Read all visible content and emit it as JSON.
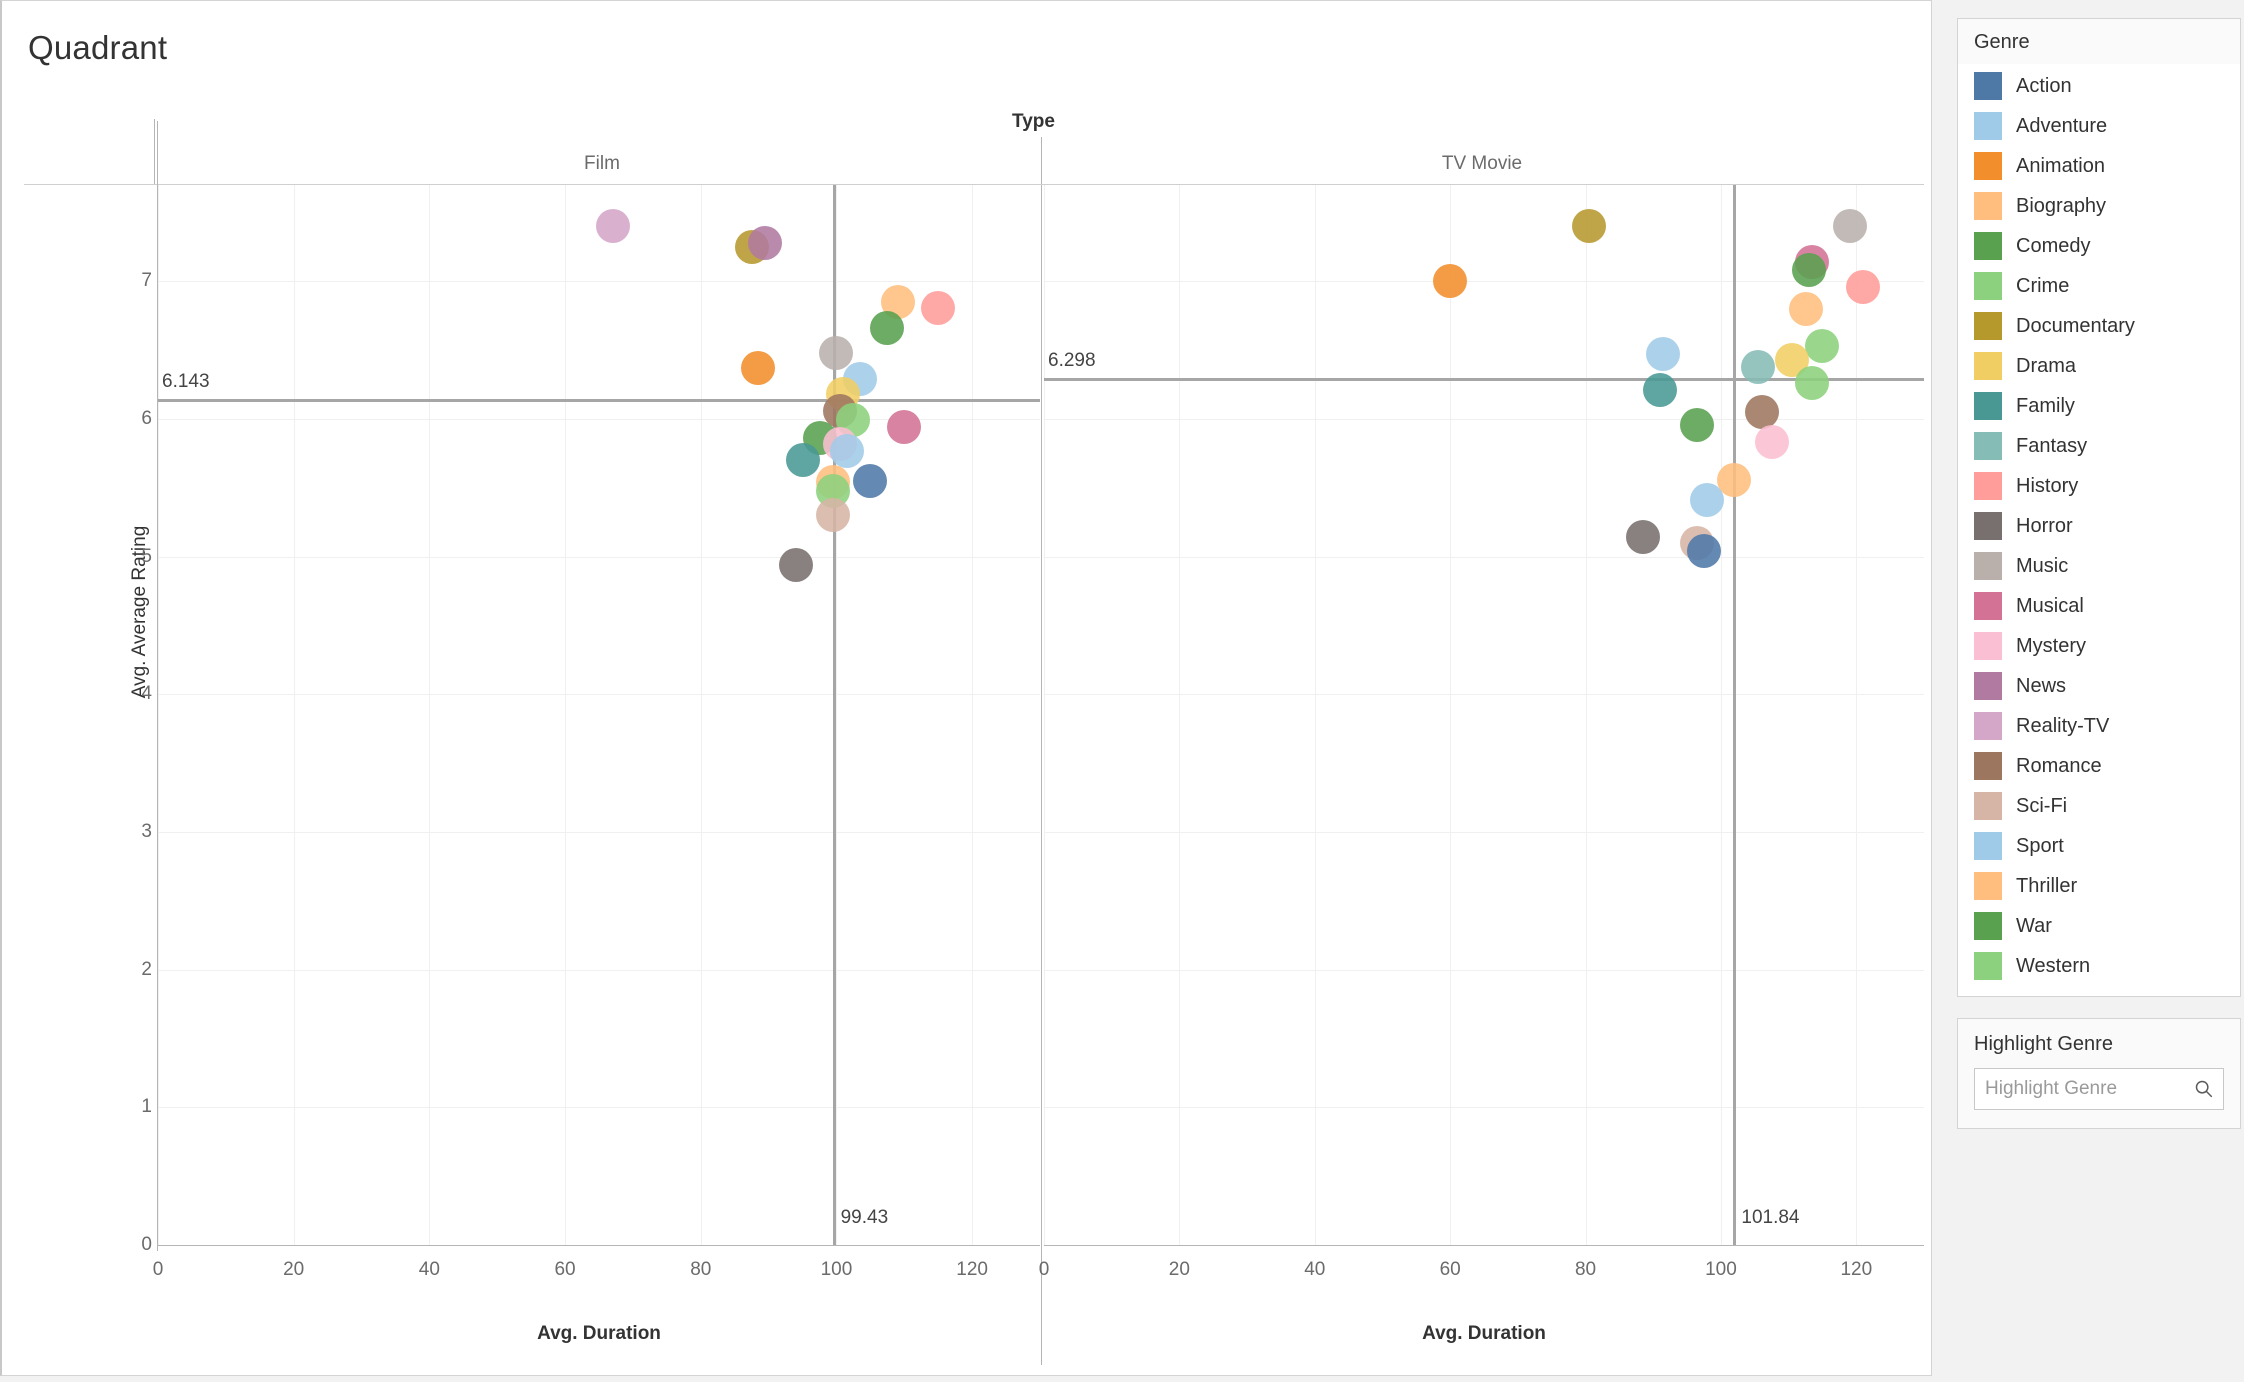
{
  "title": "Quadrant",
  "column_header": {
    "field": "Type",
    "panes": [
      "Film",
      "TV Movie"
    ]
  },
  "axes": {
    "y_title": "Avg. Average Rating",
    "x_title": "Avg. Duration",
    "y_ticks": [
      "0",
      "1",
      "2",
      "3",
      "4",
      "5",
      "6",
      "7"
    ],
    "x_ticks": [
      "0",
      "20",
      "40",
      "60",
      "80",
      "100",
      "120"
    ]
  },
  "reference_lines": {
    "film_avg_rating": "6.143",
    "film_avg_duration": "99.43",
    "tv_avg_rating": "6.298",
    "tv_avg_duration": "101.84"
  },
  "legend": {
    "title": "Genre",
    "items": [
      {
        "label": "Action",
        "color": "#4e79a7"
      },
      {
        "label": "Adventure",
        "color": "#a0cbe8"
      },
      {
        "label": "Animation",
        "color": "#f28e2b"
      },
      {
        "label": "Biography",
        "color": "#ffbe7d"
      },
      {
        "label": "Comedy",
        "color": "#59a14f"
      },
      {
        "label": "Crime",
        "color": "#8cd17d"
      },
      {
        "label": "Documentary",
        "color": "#b6992d"
      },
      {
        "label": "Drama",
        "color": "#f1ce63"
      },
      {
        "label": "Family",
        "color": "#499894"
      },
      {
        "label": "Fantasy",
        "color": "#86bcb6"
      },
      {
        "label": "History",
        "color": "#ff9d9a"
      },
      {
        "label": "Horror",
        "color": "#77706e"
      },
      {
        "label": "Music",
        "color": "#b9b0ac"
      },
      {
        "label": "Musical",
        "color": "#d37295"
      },
      {
        "label": "Mystery",
        "color": "#fabfd2"
      },
      {
        "label": "News",
        "color": "#b07aa1"
      },
      {
        "label": "Reality-TV",
        "color": "#d4a6c8"
      },
      {
        "label": "Romance",
        "color": "#9d7660"
      },
      {
        "label": "Sci-Fi",
        "color": "#d7b5a6"
      },
      {
        "label": "Sport",
        "color": "#a0cbe8"
      },
      {
        "label": "Thriller",
        "color": "#ffbe7d"
      },
      {
        "label": "War",
        "color": "#59a14f"
      },
      {
        "label": "Western",
        "color": "#8cd17d"
      }
    ]
  },
  "highlight": {
    "title": "Highlight Genre",
    "placeholder": "Highlight Genre",
    "value": "",
    "icon": "search-icon"
  },
  "chart_data": {
    "type": "scatter",
    "title": "Quadrant",
    "xlabel": "Avg. Duration",
    "ylabel": "Avg. Average Rating",
    "xlim": [
      0,
      130
    ],
    "ylim": [
      0,
      7.7
    ],
    "grid": true,
    "legend_position": "right",
    "facet_field": "Type",
    "panels": [
      {
        "name": "Film",
        "ref_x": 99.43,
        "ref_y": 6.143,
        "points": [
          {
            "genre": "Reality-TV",
            "x": 67.0,
            "y": 7.4,
            "color": "#d4a6c8"
          },
          {
            "genre": "Documentary",
            "x": 87.5,
            "y": 7.25,
            "color": "#b6992d"
          },
          {
            "genre": "News",
            "x": 89.5,
            "y": 7.28,
            "color": "#b07aa1"
          },
          {
            "genre": "Biography",
            "x": 109.0,
            "y": 6.85,
            "color": "#ffbe7d"
          },
          {
            "genre": "History",
            "x": 115.0,
            "y": 6.81,
            "color": "#ff9d9a"
          },
          {
            "genre": "War",
            "x": 107.5,
            "y": 6.66,
            "color": "#59a14f"
          },
          {
            "genre": "Music",
            "x": 100.0,
            "y": 6.48,
            "color": "#b9b0ac"
          },
          {
            "genre": "Animation",
            "x": 88.5,
            "y": 6.37,
            "color": "#f28e2b"
          },
          {
            "genre": "Adventure",
            "x": 103.5,
            "y": 6.29,
            "color": "#a0cbe8"
          },
          {
            "genre": "Drama",
            "x": 101.0,
            "y": 6.18,
            "color": "#f1ce63"
          },
          {
            "genre": "Romance",
            "x": 100.5,
            "y": 6.06,
            "color": "#9d7660"
          },
          {
            "genre": "Crime",
            "x": 102.5,
            "y": 5.99,
            "color": "#8cd17d"
          },
          {
            "genre": "Musical",
            "x": 110.0,
            "y": 5.94,
            "color": "#d37295"
          },
          {
            "genre": "Comedy",
            "x": 97.5,
            "y": 5.86,
            "color": "#59a14f"
          },
          {
            "genre": "Mystery",
            "x": 100.5,
            "y": 5.82,
            "color": "#fabfd2"
          },
          {
            "genre": "Sport",
            "x": 101.5,
            "y": 5.77,
            "color": "#a0cbe8"
          },
          {
            "genre": "Family",
            "x": 95.0,
            "y": 5.7,
            "color": "#499894"
          },
          {
            "genre": "Action",
            "x": 105.0,
            "y": 5.55,
            "color": "#4e79a7"
          },
          {
            "genre": "Thriller",
            "x": 99.5,
            "y": 5.54,
            "color": "#ffbe7d"
          },
          {
            "genre": "Western",
            "x": 99.5,
            "y": 5.48,
            "color": "#8cd17d"
          },
          {
            "genre": "Sci-Fi",
            "x": 99.5,
            "y": 5.3,
            "color": "#d7b5a6"
          },
          {
            "genre": "Horror",
            "x": 94.0,
            "y": 4.94,
            "color": "#77706e"
          }
        ]
      },
      {
        "name": "TV Movie",
        "ref_x": 101.84,
        "ref_y": 6.298,
        "points": [
          {
            "genre": "Music",
            "x": 119.0,
            "y": 7.4,
            "color": "#b9b0ac"
          },
          {
            "genre": "Documentary",
            "x": 80.5,
            "y": 7.4,
            "color": "#b6992d"
          },
          {
            "genre": "Musical",
            "x": 113.5,
            "y": 7.14,
            "color": "#d37295"
          },
          {
            "genre": "War",
            "x": 113.0,
            "y": 7.08,
            "color": "#59a14f"
          },
          {
            "genre": "Animation",
            "x": 60.0,
            "y": 7.0,
            "color": "#f28e2b"
          },
          {
            "genre": "History",
            "x": 121.0,
            "y": 6.96,
            "color": "#ff9d9a"
          },
          {
            "genre": "Biography",
            "x": 112.5,
            "y": 6.8,
            "color": "#ffbe7d"
          },
          {
            "genre": "Crime",
            "x": 115.0,
            "y": 6.53,
            "color": "#8cd17d"
          },
          {
            "genre": "Adventure",
            "x": 91.5,
            "y": 6.47,
            "color": "#a0cbe8"
          },
          {
            "genre": "Drama",
            "x": 110.5,
            "y": 6.43,
            "color": "#f1ce63"
          },
          {
            "genre": "Fantasy",
            "x": 105.5,
            "y": 6.38,
            "color": "#86bcb6"
          },
          {
            "genre": "Western",
            "x": 113.5,
            "y": 6.26,
            "color": "#8cd17d"
          },
          {
            "genre": "Family",
            "x": 91.0,
            "y": 6.21,
            "color": "#499894"
          },
          {
            "genre": "Romance",
            "x": 106.0,
            "y": 6.05,
            "color": "#9d7660"
          },
          {
            "genre": "Comedy",
            "x": 96.5,
            "y": 5.96,
            "color": "#59a14f"
          },
          {
            "genre": "Mystery",
            "x": 107.5,
            "y": 5.83,
            "color": "#fabfd2"
          },
          {
            "genre": "Thriller",
            "x": 102.0,
            "y": 5.56,
            "color": "#ffbe7d"
          },
          {
            "genre": "Sport",
            "x": 98.0,
            "y": 5.41,
            "color": "#a0cbe8"
          },
          {
            "genre": "Horror",
            "x": 88.5,
            "y": 5.14,
            "color": "#77706e"
          },
          {
            "genre": "Sci-Fi",
            "x": 96.5,
            "y": 5.1,
            "color": "#d7b5a6"
          },
          {
            "genre": "Action",
            "x": 97.5,
            "y": 5.04,
            "color": "#4e79a7"
          }
        ]
      }
    ]
  }
}
